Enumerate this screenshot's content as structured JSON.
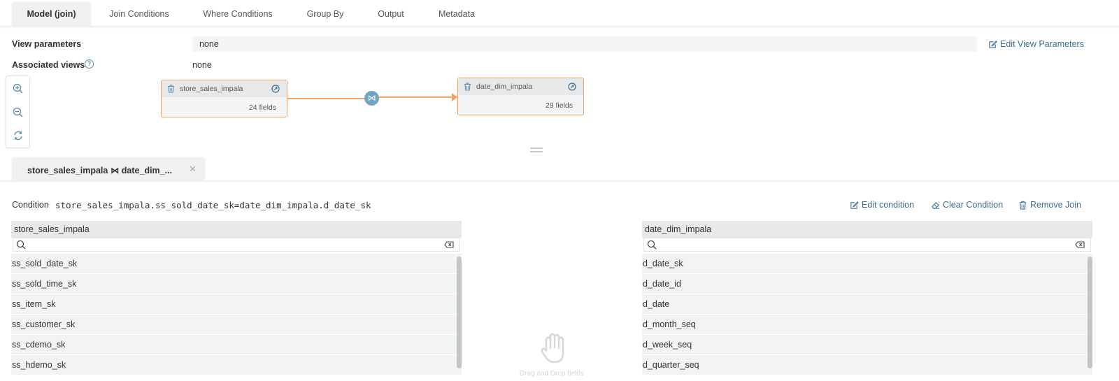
{
  "tabs": [
    {
      "label": "Model (join)"
    },
    {
      "label": "Join Conditions"
    },
    {
      "label": "Where Conditions"
    },
    {
      "label": "Group By"
    },
    {
      "label": "Output"
    },
    {
      "label": "Metadata"
    }
  ],
  "view_parameters": {
    "label": "View parameters",
    "value": "none",
    "edit_label": "Edit View Parameters"
  },
  "associated_views": {
    "label": "Associated views",
    "value": "none"
  },
  "diagram": {
    "left_node": {
      "name": "store_sales_impala",
      "fields": "24 fields"
    },
    "right_node": {
      "name": "date_dim_impala",
      "fields": "29 fields"
    },
    "join_symbol": "⋈"
  },
  "join_tab": {
    "label": "store_sales_impala ⋈ date_dim_...",
    "close": "✕"
  },
  "condition": {
    "label": "Condition",
    "expression": "store_sales_impala.ss_sold_date_sk=date_dim_impala.d_date_sk",
    "edit_label": "Edit condition",
    "clear_label": "Clear Condition",
    "remove_label": "Remove Join"
  },
  "left_list": {
    "title": "store_sales_impala",
    "fields": [
      "ss_sold_date_sk",
      "ss_sold_time_sk",
      "ss_item_sk",
      "ss_customer_sk",
      "ss_cdemo_sk",
      "ss_hdemo_sk"
    ]
  },
  "right_list": {
    "title": "date_dim_impala",
    "fields": [
      "d_date_sk",
      "d_date_id",
      "d_date",
      "d_month_seq",
      "d_week_seq",
      "d_quarter_seq"
    ]
  },
  "drag_hint": "Drag and Drop fields",
  "colors": {
    "accent": "#f5a35c",
    "link": "#3d6f8e",
    "join": "#6fa4c3"
  }
}
